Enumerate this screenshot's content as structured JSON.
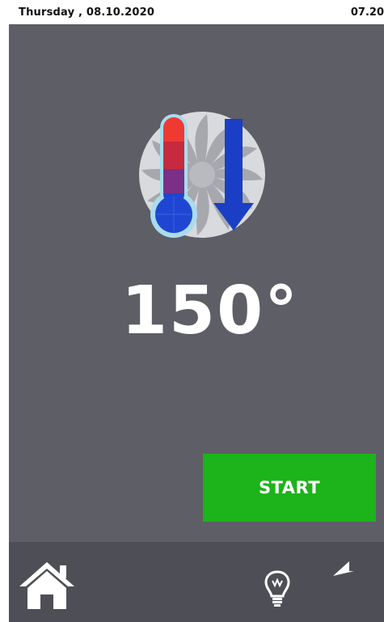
{
  "status_bar": {
    "date": "Thursday , 08.10.2020",
    "time": "07.20"
  },
  "main": {
    "mode_icon": "fan-thermometer-lower-heat-icon",
    "temperature": "150°",
    "start_label": "START"
  },
  "bottom_bar": {
    "home_icon": "home-icon",
    "light_icon": "light-bulb-icon",
    "back_icon": "back-arrow-icon"
  },
  "colors": {
    "panel": "#5d5e66",
    "bottom_bar": "#4e4f56",
    "start_button": "#1db31a",
    "arrow_blue": "#1a3fc4",
    "thermometer_red": "#e8322f"
  }
}
